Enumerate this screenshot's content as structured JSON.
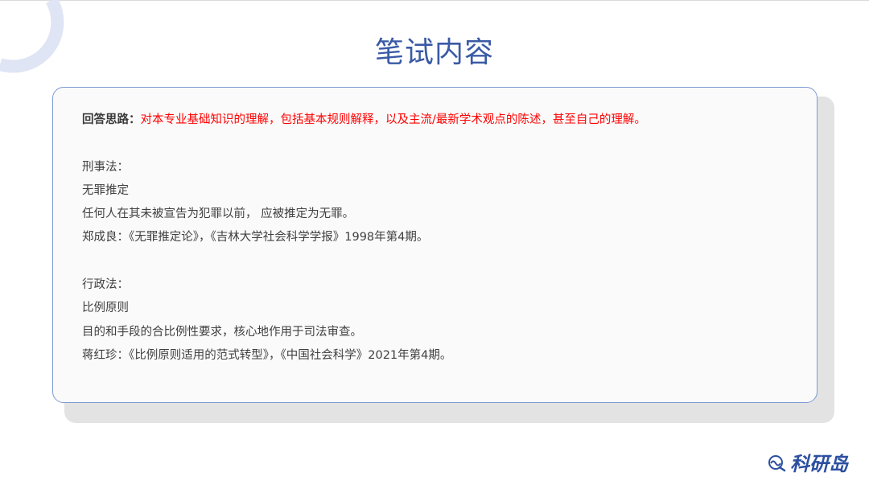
{
  "title": "笔试内容",
  "card": {
    "answer": {
      "label": "回答思路：",
      "text": "对本专业基础知识的理解，包括基本规则解释，以及主流/最新学术观点的陈述，甚至自己的理解。"
    },
    "sections": [
      {
        "heading": "刑事法：",
        "principle": "无罪推定",
        "description": "任何人在其未被宣告为犯罪以前， 应被推定为无罪。",
        "citation": "郑成良：《无罪推定论》，《吉林大学社会科学学报》1998年第4期。"
      },
      {
        "heading": "行政法：",
        "principle": "比例原则",
        "description": "目的和手段的合比例性要求，核心地作用于司法审查。",
        "citation": "蒋红珍：《比例原则适用的范式转型》，《中国社会科学》2021年第4期。"
      }
    ]
  },
  "logo": {
    "text": "科研岛",
    "icon": "wave-globe-icon"
  },
  "colors": {
    "title": "#3a5aa6",
    "highlight": "#ff0000",
    "border": "#7c9ad6",
    "logo": "#2c4fa0"
  }
}
